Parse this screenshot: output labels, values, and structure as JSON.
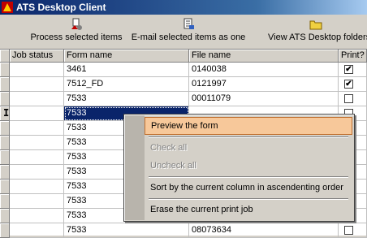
{
  "window": {
    "title": "ATS Desktop Client"
  },
  "toolbar": {
    "process_label": "Process selected items",
    "email_label": "E-mail selected items as one",
    "view_label": "View ATS Desktop folders"
  },
  "grid": {
    "headers": {
      "job_status": "Job status",
      "form_name": "Form name",
      "file_name": "File name",
      "print": "Print?"
    },
    "rows": [
      {
        "job_status": "",
        "form_name": "3461",
        "file_name": "0140038",
        "print": true
      },
      {
        "job_status": "",
        "form_name": "7512_FD",
        "file_name": "0121997",
        "print": true
      },
      {
        "job_status": "",
        "form_name": "7533",
        "file_name": "00011079",
        "print": false
      },
      {
        "job_status": "",
        "form_name": "7533",
        "file_name": "",
        "print": false
      },
      {
        "job_status": "",
        "form_name": "7533",
        "file_name": "",
        "print": false
      },
      {
        "job_status": "",
        "form_name": "7533",
        "file_name": "",
        "print": false
      },
      {
        "job_status": "",
        "form_name": "7533",
        "file_name": "",
        "print": false
      },
      {
        "job_status": "",
        "form_name": "7533",
        "file_name": "",
        "print": false
      },
      {
        "job_status": "",
        "form_name": "7533",
        "file_name": "",
        "print": false
      },
      {
        "job_status": "",
        "form_name": "7533",
        "file_name": "",
        "print": false
      },
      {
        "job_status": "",
        "form_name": "7533",
        "file_name": "",
        "print": false
      },
      {
        "job_status": "",
        "form_name": "7533",
        "file_name": "08073634",
        "print": false
      }
    ]
  },
  "context_menu": {
    "items": [
      {
        "label": "Preview the form",
        "state": "highlighted"
      },
      {
        "label": "Check all",
        "state": "disabled"
      },
      {
        "label": "Uncheck all",
        "state": "disabled"
      },
      {
        "label": "Sort by the current column in ascendenting order",
        "state": "enabled"
      },
      {
        "label": "Erase the current print job",
        "state": "enabled"
      }
    ]
  },
  "cursor": {
    "glyph": "I"
  },
  "icons": {
    "app": "app-icon",
    "process": "process-icon",
    "email": "email-icon",
    "folder": "folder-icon"
  },
  "colors": {
    "title_start": "#0a246a",
    "selection": "#0a246a",
    "menu_highlight": "#f7c89a"
  }
}
